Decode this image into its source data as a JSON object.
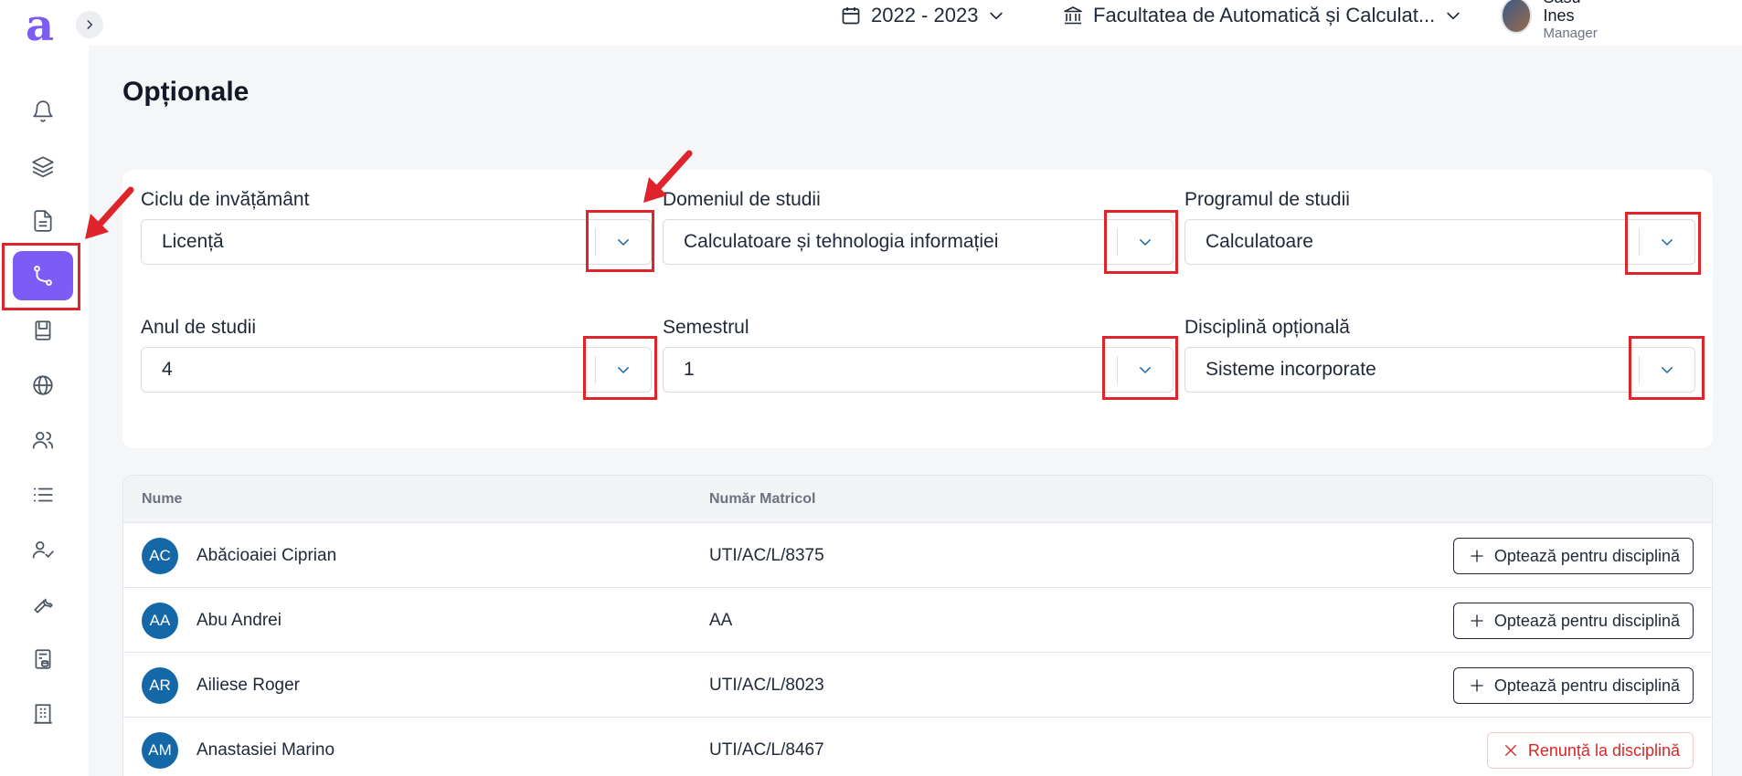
{
  "app": {
    "logo_letter": "a"
  },
  "topbar": {
    "year": "2022 - 2023",
    "faculty": "Facultatea de Automatică și Calculat...",
    "user": {
      "name": "Sasu Ines",
      "role": "Manager"
    }
  },
  "sidebar": {
    "items": [
      {
        "id": "notifications",
        "icon": "bell-icon"
      },
      {
        "id": "layers",
        "icon": "layers-icon"
      },
      {
        "id": "documents",
        "icon": "document-icon"
      },
      {
        "id": "optionale",
        "icon": "route-icon",
        "active": true
      },
      {
        "id": "book",
        "icon": "book-icon"
      },
      {
        "id": "globe",
        "icon": "globe-icon"
      },
      {
        "id": "users",
        "icon": "users-icon"
      },
      {
        "id": "list",
        "icon": "list-icon"
      },
      {
        "id": "user-check",
        "icon": "user-check-icon"
      },
      {
        "id": "tools",
        "icon": "wrench-icon"
      },
      {
        "id": "finance",
        "icon": "coins-icon"
      },
      {
        "id": "building",
        "icon": "building-icon"
      }
    ]
  },
  "page": {
    "title": "Opționale"
  },
  "filters": {
    "ciclu": {
      "label": "Ciclu de invățământ",
      "value": "Licență"
    },
    "domeniu": {
      "label": "Domeniul de studii",
      "value": "Calculatoare și tehnologia informației"
    },
    "program": {
      "label": "Programul de studii",
      "value": "Calculatoare"
    },
    "an": {
      "label": "Anul de studii",
      "value": "4"
    },
    "semestru": {
      "label": "Semestrul",
      "value": "1"
    },
    "disciplina": {
      "label": "Disciplină opțională",
      "value": "Sisteme incorporate"
    }
  },
  "table": {
    "headers": {
      "name": "Nume",
      "matricol": "Număr Matricol"
    },
    "rows": [
      {
        "initials": "AC",
        "name": "Abăcioaiei Ciprian",
        "matricol": "UTI/AC/L/8375",
        "action": "Optează pentru disciplină",
        "action_type": "opt"
      },
      {
        "initials": "AA",
        "name": "Abu Andrei",
        "matricol": "AA",
        "action": "Optează pentru disciplină",
        "action_type": "opt"
      },
      {
        "initials": "AR",
        "name": "Ailiese Roger",
        "matricol": "UTI/AC/L/8023",
        "action": "Optează pentru disciplină",
        "action_type": "opt"
      },
      {
        "initials": "AM",
        "name": "Anastasiei Marino",
        "matricol": "UTI/AC/L/8467",
        "action": "Renunță la disciplină",
        "action_type": "cancel"
      }
    ]
  },
  "colors": {
    "accent": "#7c5cf5",
    "avatar_bg": "#1468a8",
    "danger": "#d62828",
    "highlight": "#e0242b"
  }
}
